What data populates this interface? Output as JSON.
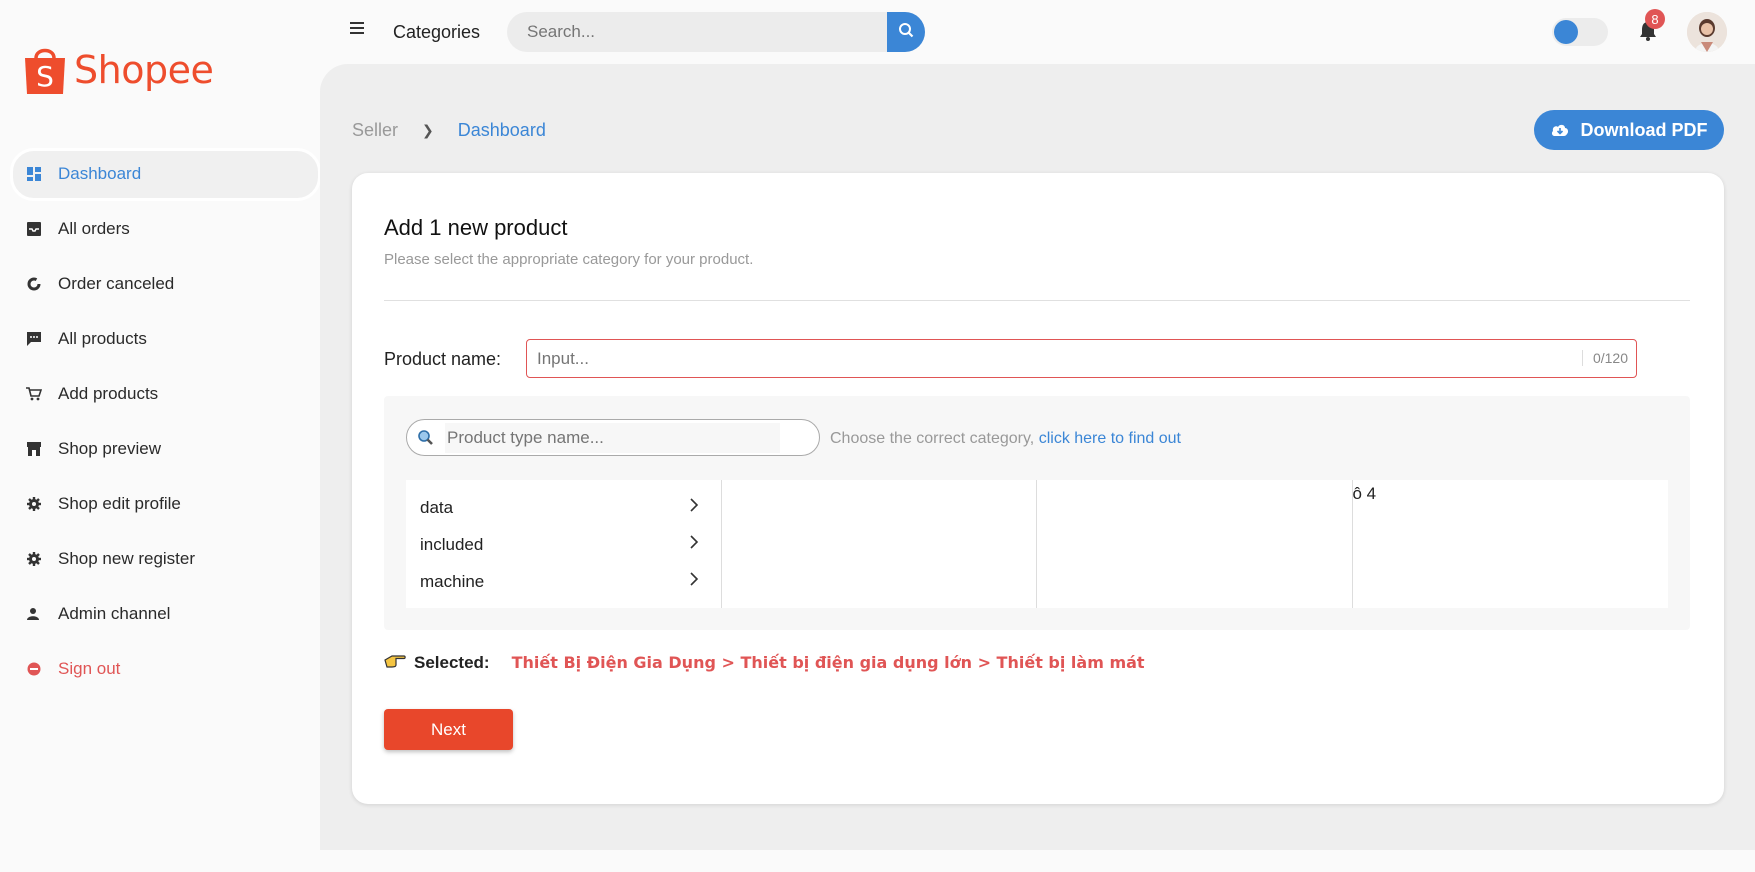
{
  "brand": {
    "name": "Shopee",
    "color": "#ee4d2d"
  },
  "sidebar": {
    "items": [
      {
        "label": "Dashboard",
        "icon": "dashboard-icon"
      },
      {
        "label": "All orders",
        "icon": "inbox-icon"
      },
      {
        "label": "Order canceled",
        "icon": "donut-icon"
      },
      {
        "label": "All products",
        "icon": "chat-icon"
      },
      {
        "label": "Add products",
        "icon": "cart-icon"
      },
      {
        "label": "Shop preview",
        "icon": "store-icon"
      },
      {
        "label": "Shop edit profile",
        "icon": "gear-icon"
      },
      {
        "label": "Shop new register",
        "icon": "gear-icon"
      },
      {
        "label": "Admin channel",
        "icon": "user-icon"
      },
      {
        "label": "Sign out",
        "icon": "minus-circle-icon"
      }
    ]
  },
  "header": {
    "categories_label": "Categories",
    "search_placeholder": "Search...",
    "notification_count": "8"
  },
  "breadcrumb": {
    "seller": "Seller",
    "current": "Dashboard"
  },
  "download_pdf_label": "Download PDF",
  "card": {
    "title": "Add 1 new product",
    "subtitle": "Please select the appropriate category for your product.",
    "product_name_label": "Product name:",
    "product_name_placeholder": "Input...",
    "product_name_count": "0/120",
    "product_type_placeholder": "Product type name...",
    "hint_text": "Choose the correct category, ",
    "hint_link": "click here to find out",
    "categories": [
      "data",
      "included",
      "machine"
    ],
    "column4_text": "ô 4",
    "selected_label": "Selected:",
    "selected_path": "Thiết Bị Điện Gia Dụng > Thiết bị điện gia dụng lớn > Thiết bị làm mát",
    "next_label": "Next"
  },
  "colors": {
    "accent": "#3b86d6",
    "error": "#e05555",
    "next": "#e8472b"
  }
}
